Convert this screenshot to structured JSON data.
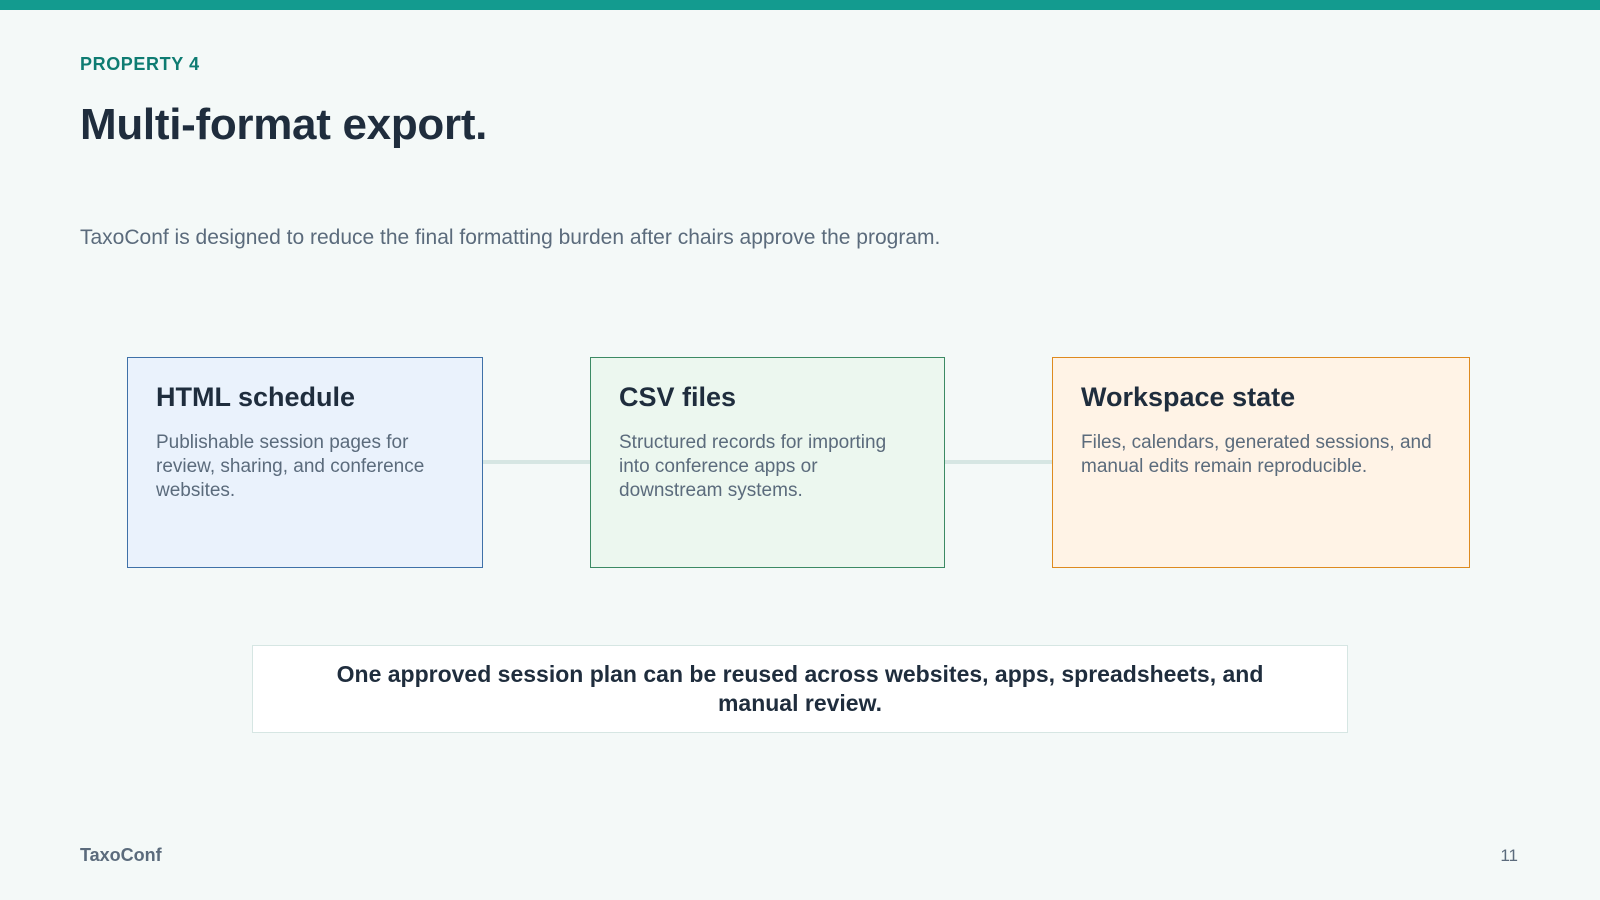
{
  "header": {
    "eyebrow": "PROPERTY 4",
    "title": "Multi-format export.",
    "subtitle": "TaxoConf is designed to reduce the final formatting burden after chairs approve the program."
  },
  "cards": [
    {
      "title": "HTML schedule",
      "body": "Publishable session pages for review, sharing, and conference websites.",
      "accent": "#3f71a8",
      "background": "#eaf2fc"
    },
    {
      "title": "CSV files",
      "body": "Structured records for importing into conference apps or downstream systems.",
      "accent": "#3c8a64",
      "background": "#ecf7ef"
    },
    {
      "title": "Workspace state",
      "body": "Files, calendars, generated sessions, and manual edits remain reproducible.",
      "accent": "#de8a1f",
      "background": "#fff3e6"
    }
  ],
  "takeaway": "One approved session plan can be reused across websites, apps, spreadsheets, and manual review.",
  "footer": {
    "brand": "TaxoConf",
    "page_number": "11"
  },
  "colors": {
    "brand_teal": "#139b8f",
    "eyebrow_teal": "#0e7c72",
    "text_dark": "#1f2d3d",
    "text_muted": "#5b6b7c",
    "background": "#f4f9f8"
  }
}
